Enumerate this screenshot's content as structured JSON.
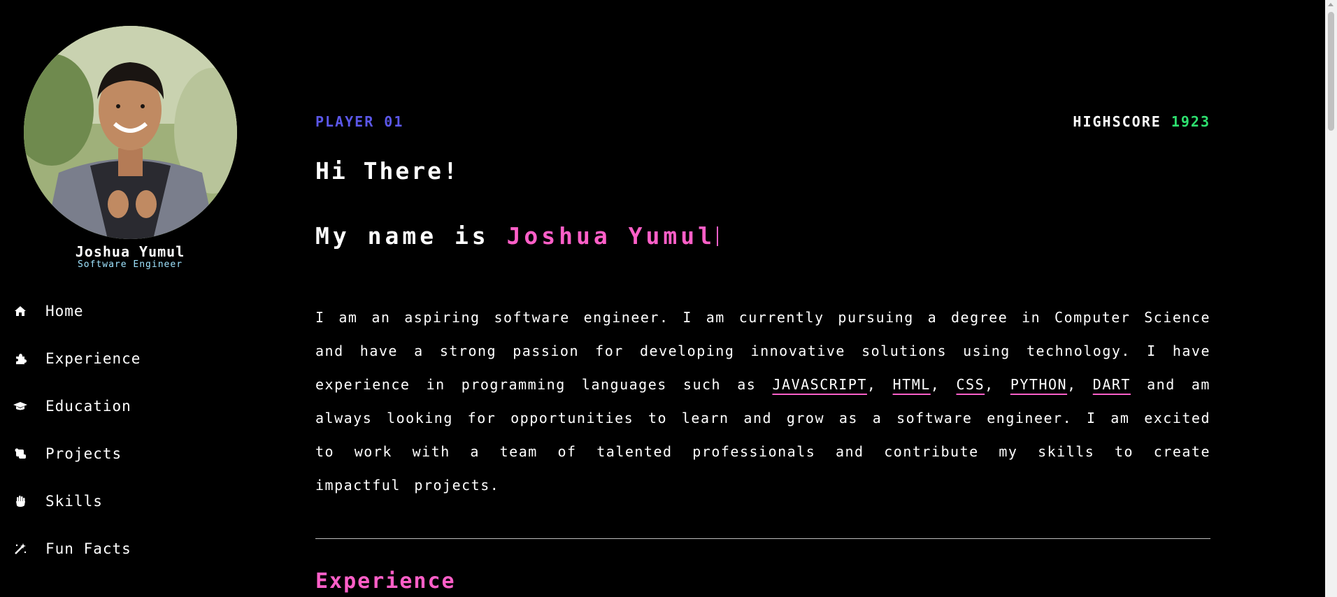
{
  "profile": {
    "name": "Joshua Yumul",
    "role": "Software Engineer"
  },
  "nav": {
    "items": [
      {
        "label": "Home",
        "icon": "home-icon"
      },
      {
        "label": "Experience",
        "icon": "puzzle-icon"
      },
      {
        "label": "Education",
        "icon": "graduation-cap-icon"
      },
      {
        "label": "Projects",
        "icon": "scroll-icon"
      },
      {
        "label": "Skills",
        "icon": "hand-icon"
      },
      {
        "label": "Fun Facts",
        "icon": "magic-wand-icon"
      }
    ]
  },
  "header": {
    "player": "PLAYER 01",
    "highscore_label": "HIGHSCORE",
    "highscore_value": "1923"
  },
  "hero": {
    "greeting": "Hi There!",
    "intro_prefix": "My name is",
    "intro_name": "Joshua Yumul"
  },
  "bio": {
    "part1": "I am an aspiring software engineer. I am currently pursuing a degree in Computer Science and have a strong passion for developing innovative solutions using technology. I have experience in programming languages such as",
    "languages": [
      "JAVASCRIPT",
      "HTML",
      "CSS",
      "PYTHON",
      "DART"
    ],
    "part2": "and am always looking for opportunities to learn and grow as a software engineer. I am excited to work with a team of talented professionals and contribute my skills to create impactful projects."
  },
  "sections": {
    "experience_title": "Experience"
  },
  "colors": {
    "background": "#000000",
    "accent_pink": "#ff5fc8",
    "player_blue": "#5b57e8",
    "score_green": "#2ee06f",
    "role_cyan": "#9fe4ff"
  }
}
